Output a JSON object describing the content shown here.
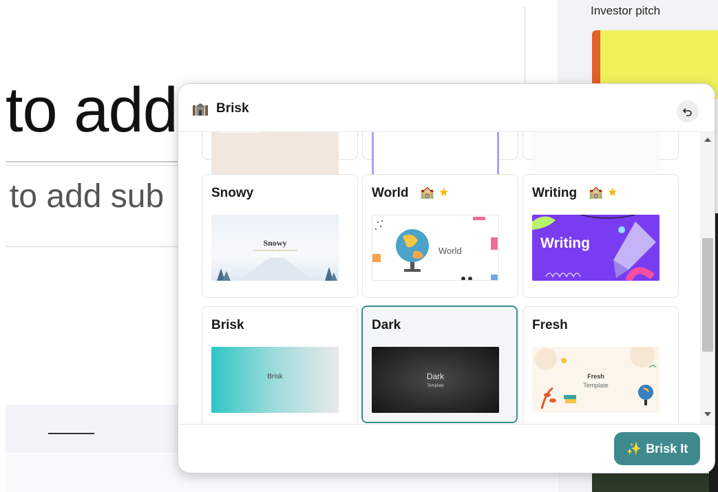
{
  "background": {
    "slide_title": "to add",
    "slide_subtitle": "to add sub",
    "side_panel_title": "Investor pitch"
  },
  "popup": {
    "brand": "Brisk",
    "back_icon": "undo-icon",
    "templates": [
      {
        "label": "Snowy",
        "badges": [],
        "thumb_text": "Snowy"
      },
      {
        "label": "World",
        "badges": [
          "school-icon",
          "star-icon"
        ],
        "thumb_text": "World"
      },
      {
        "label": "Writing",
        "badges": [
          "school-icon",
          "star-icon"
        ],
        "thumb_text": "Writing"
      },
      {
        "label": "Brisk",
        "badges": [],
        "thumb_text": "Brisk"
      },
      {
        "label": "Dark",
        "badges": [],
        "thumb_text": "Dark",
        "thumb_subtext": "Template",
        "selected": true
      },
      {
        "label": "Fresh",
        "badges": [],
        "thumb_text": "Fresh",
        "thumb_subtext": "Template"
      }
    ],
    "action_button": "Brisk It",
    "colors": {
      "accent": "#3e8a8d",
      "star": "#f5b700",
      "writing_bg": "#7a3cf0"
    }
  }
}
